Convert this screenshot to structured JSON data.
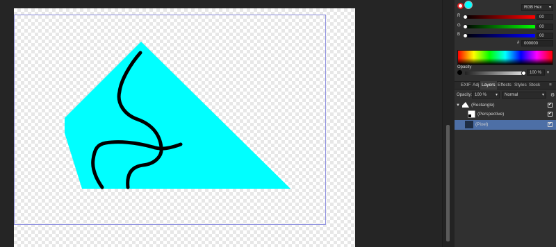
{
  "canvas": {
    "shape_color": "#00ffff",
    "stroke_color": "#000000",
    "selection_color": "#8d8fe0"
  },
  "color_panel": {
    "mode": "RGB Hex",
    "r_value": "00",
    "g_value": "00",
    "b_value": "00",
    "r_label": "R",
    "g_label": "G",
    "b_label": "B",
    "hex_value": "000000",
    "hex_marker": "#",
    "opacity_label": "Opacity",
    "opacity_value": "100 %",
    "foreground_color": "#00ffff",
    "dropdown_caret": "▾"
  },
  "tabs": {
    "items": [
      {
        "label": "EXIF"
      },
      {
        "label": "Adj"
      },
      {
        "label": "Layers"
      },
      {
        "label": "Effects"
      },
      {
        "label": "Styles"
      },
      {
        "label": "Stock"
      }
    ],
    "active": "Layers",
    "menu_glyph": "≡"
  },
  "layers_panel": {
    "opacity_label": "Opacity:",
    "opacity_value": "100 %",
    "blend_mode": "Normal",
    "layers": [
      {
        "name": "(Rectangle)",
        "expanded": true,
        "visible": true
      },
      {
        "name": "(Perspective)",
        "visible": true
      },
      {
        "name": "(Pixel)",
        "visible": true,
        "selected": true
      }
    ],
    "check_glyph": "✔"
  }
}
